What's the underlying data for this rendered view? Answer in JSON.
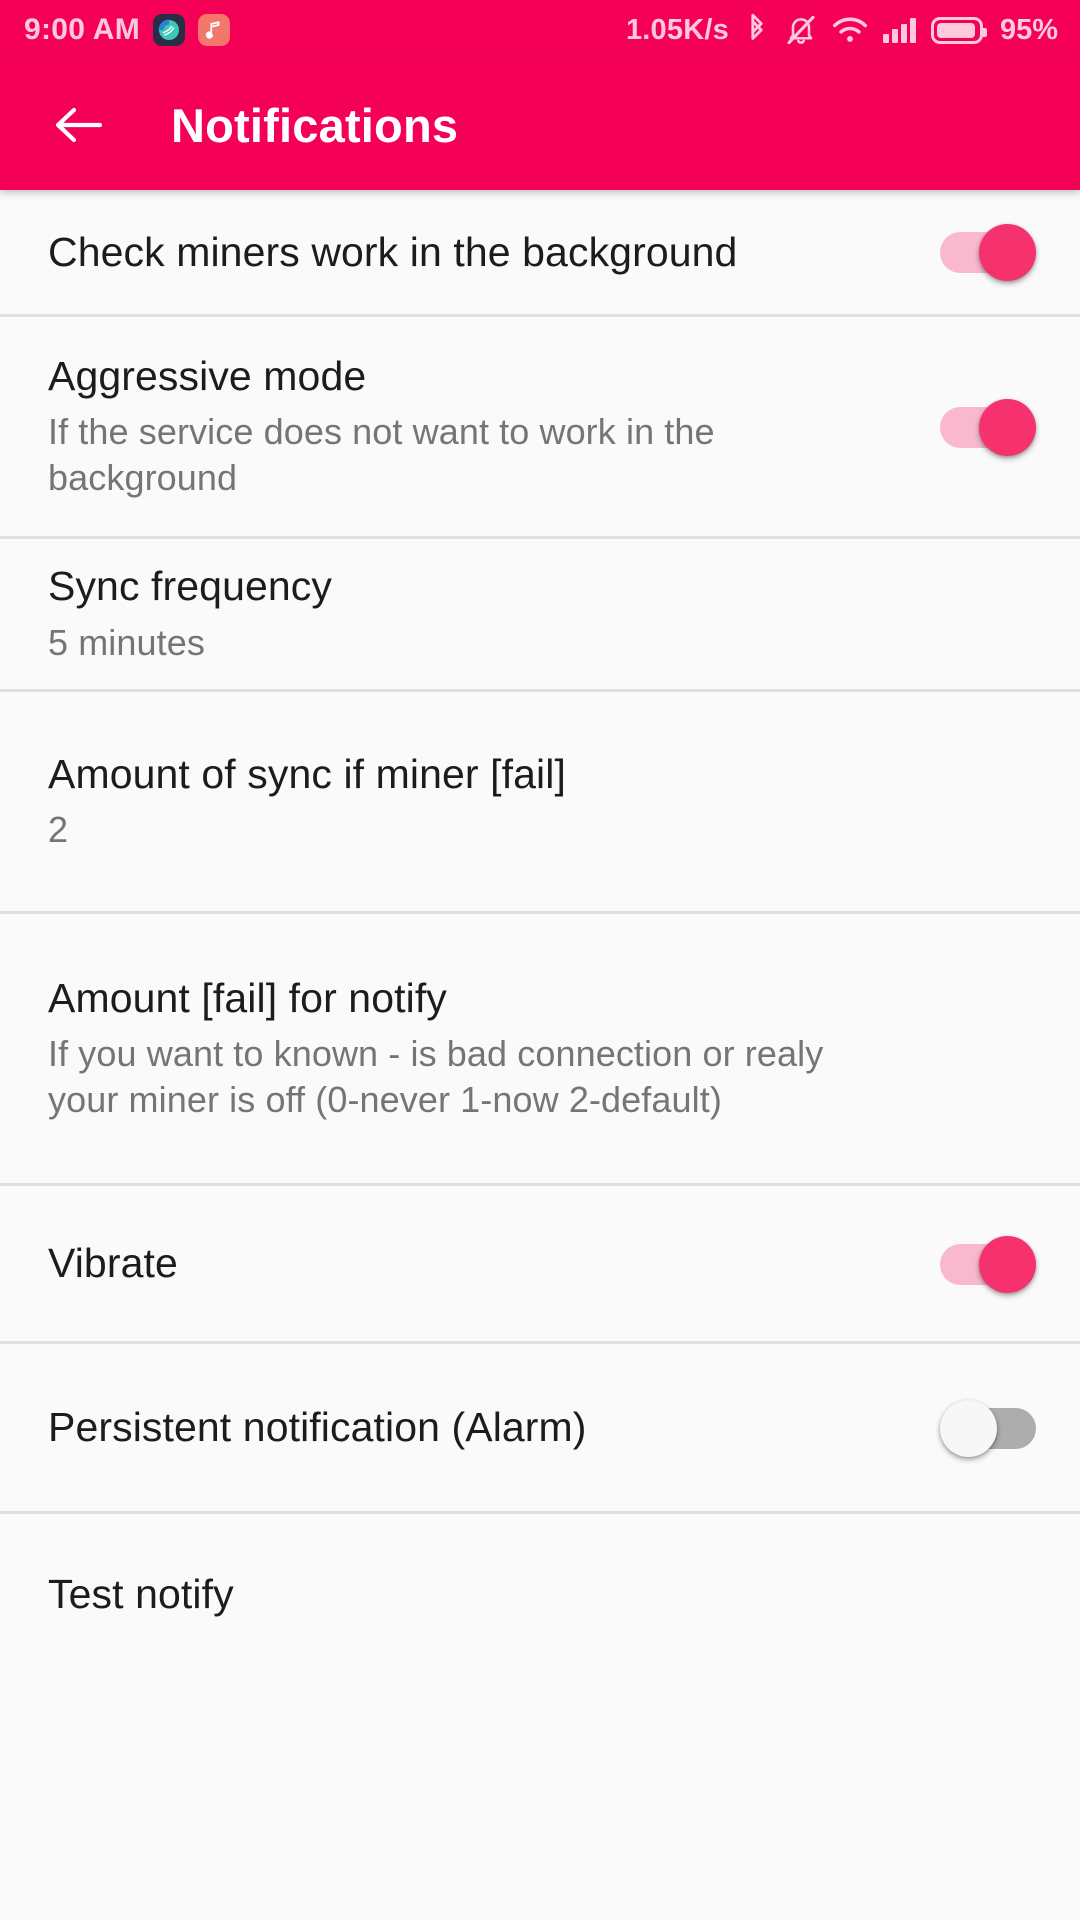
{
  "status_bar": {
    "clock": "9:00 AM",
    "network_speed": "1.05K/s",
    "battery_percent": "95%",
    "icons": [
      "swipe-app-notification-icon",
      "music-note-app-notification-icon",
      "bluetooth-icon",
      "ringer-muted-icon",
      "wifi-icon",
      "cellular-signal-icon",
      "battery-icon"
    ]
  },
  "app_bar": {
    "title": "Notifications",
    "back_icon": "back-arrow-icon",
    "background_color": "#F50057"
  },
  "colors": {
    "accent": "#F50057",
    "switch_on_thumb": "#F5326E",
    "switch_on_track": "#F9B8CE",
    "switch_off_track": "#ADADAD",
    "page_background": "#FAFAFA",
    "divider": "#E0E0E0"
  },
  "preferences": [
    {
      "title": "Check miners work in the background",
      "summary": "",
      "control": "switch",
      "state": "on"
    },
    {
      "title": "Aggressive mode",
      "summary": "If the service does not want to work in the background",
      "control": "switch",
      "state": "on"
    },
    {
      "title": "Sync frequency",
      "summary": "5 minutes",
      "control": "none",
      "state": ""
    },
    {
      "title": "Amount of sync if miner [fail]",
      "summary": "2",
      "control": "none",
      "state": ""
    },
    {
      "title": "Amount [fail] for notify",
      "summary": "If you want to known - is bad connection or realy your miner is off (0-never 1-now 2-default)",
      "control": "none",
      "state": ""
    },
    {
      "title": "Vibrate",
      "summary": "",
      "control": "switch",
      "state": "on"
    },
    {
      "title": "Persistent notification (Alarm)",
      "summary": "",
      "control": "switch",
      "state": "off"
    },
    {
      "title": "Test notify",
      "summary": "",
      "control": "none",
      "state": ""
    }
  ]
}
